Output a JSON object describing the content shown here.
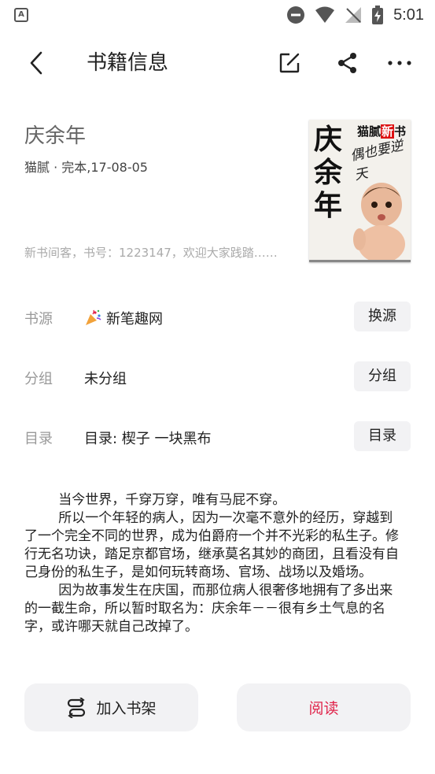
{
  "status_bar": {
    "time": "5:01",
    "app_indicator": "A",
    "icons": [
      "dnd-icon",
      "wifi-icon",
      "no-signal-icon",
      "battery-charging-icon"
    ]
  },
  "toolbar": {
    "title": "书籍信息",
    "icons": [
      "back-arrow-icon",
      "edit-icon",
      "share-icon",
      "more-icon"
    ]
  },
  "book": {
    "title": "庆余年",
    "meta": "猫腻 · 完本,17-08-05",
    "short_intro": "新书间客，书号：1223147，欢迎大家践踏……",
    "cover": {
      "author": "猫腻",
      "badge": "新",
      "badge_suffix": "书",
      "title": "庆余年",
      "slogan": "偶也要逆天"
    }
  },
  "rows": [
    {
      "label": "书源",
      "value": "新笔趣网",
      "button": "换源",
      "icon": "party-popper-icon"
    },
    {
      "label": "分组",
      "value": "未分组",
      "button": "分组"
    },
    {
      "label": "目录",
      "value": "目录: 楔子 一块黑布",
      "button": "目录"
    }
  ],
  "intro": "        当今世界，千穿万穿，唯有马屁不穿。\n        所以一个年轻的病人，因为一次毫不意外的经历，穿越到了一个完全不同的世界，成为伯爵府一个并不光彩的私生子。修行无名功诀，踏足京都官场，继承莫名其妙的商团，且看没有自己身份的私生子，是如何玩转商场、官场、战场以及婚场。\n        因为故事发生在庆国，而那位病人很奢侈地拥有了多出来的一截生命，所以暂时取名为：庆余年－－很有乡土气息的名字，或许哪天就自己改掉了。",
  "actions": {
    "add_shelf": "加入书架",
    "read": "阅读"
  },
  "colors": {
    "accent": "#e0234a",
    "button_bg": "#f2f2f4"
  }
}
